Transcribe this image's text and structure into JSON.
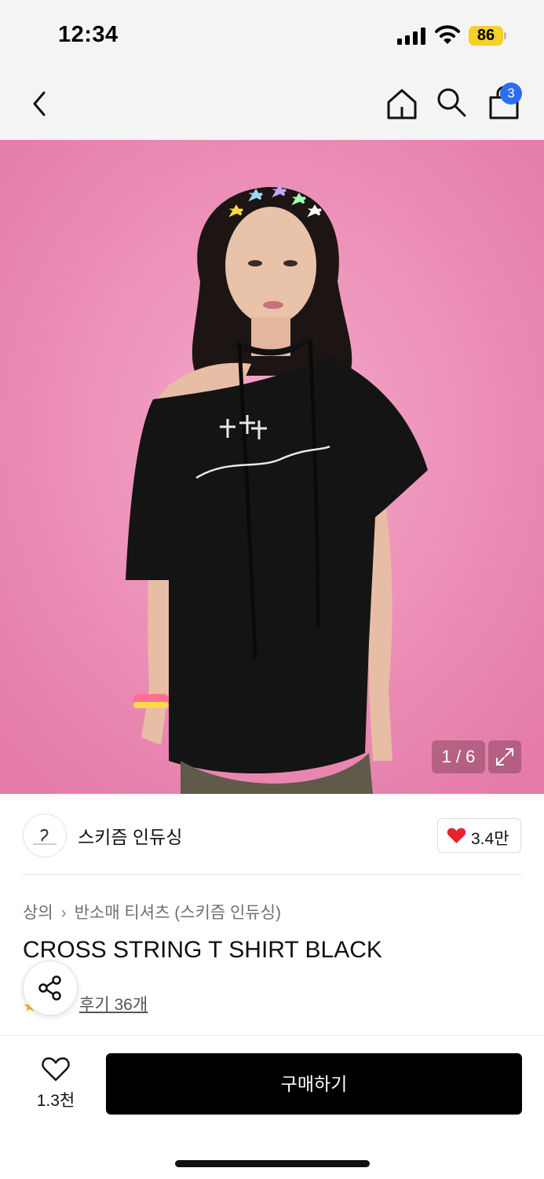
{
  "status_bar": {
    "time": "12:34",
    "battery": "86"
  },
  "nav": {
    "cart_badge": "3"
  },
  "gallery": {
    "counter": "1 / 6"
  },
  "brand": {
    "name": "스키즘 인듀싱",
    "likes": "3.4만"
  },
  "product": {
    "breadcrumb": [
      "상의",
      "반소매 티셔츠 (스키즘 인듀싱)"
    ],
    "title": "CROSS STRING T SHIRT BLACK",
    "review_link": "후기 36개"
  },
  "bottom_bar": {
    "wish_count": "1.3천",
    "buy_label": "구매하기"
  },
  "colors": {
    "accent": "#2b6ef5",
    "heart": "#e8222e",
    "buy_button": "#000000",
    "photo_background": "#ee8ab5"
  }
}
